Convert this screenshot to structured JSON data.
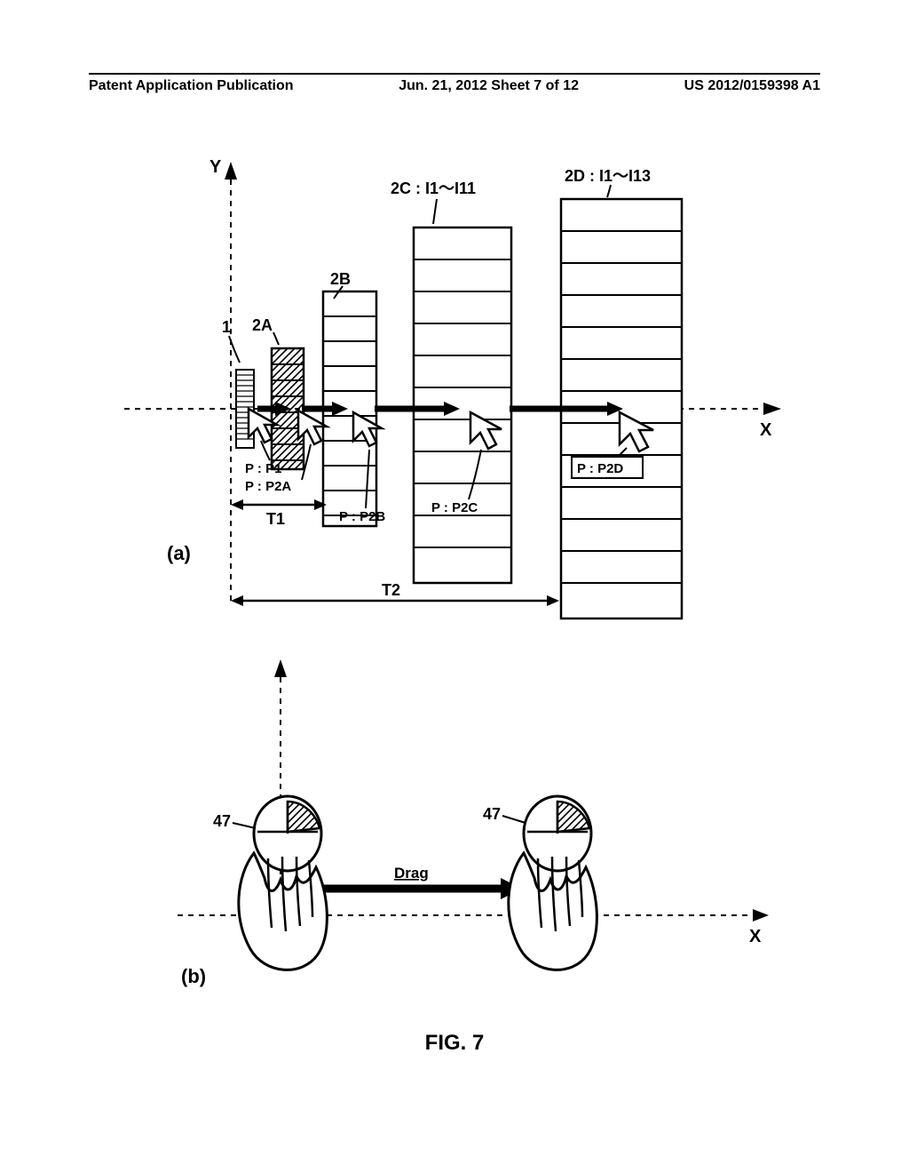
{
  "header": {
    "left": "Patent Application Publication",
    "center": "Jun. 21, 2012  Sheet 7 of 12",
    "right": "US 2012/0159398 A1"
  },
  "diagram_a": {
    "sub_label": "(a)",
    "axis_x": "X",
    "axis_y": "Y",
    "labels": {
      "item1": "1",
      "item2A": "2A",
      "item2B": "2B",
      "item2C": "2C : I1～I11",
      "item2D": "2D : I1～I13",
      "P1": "P : P1",
      "P2A": "P : P2A",
      "P2B": "P : P2B",
      "P2C": "P : P2C",
      "P2D": "P : P2D",
      "T1": "T1",
      "T2": "T2"
    }
  },
  "diagram_b": {
    "sub_label": "(b)",
    "axis_x": "X",
    "mouse_label": "47",
    "drag_label": "Drag"
  },
  "figure_caption": "FIG. 7"
}
